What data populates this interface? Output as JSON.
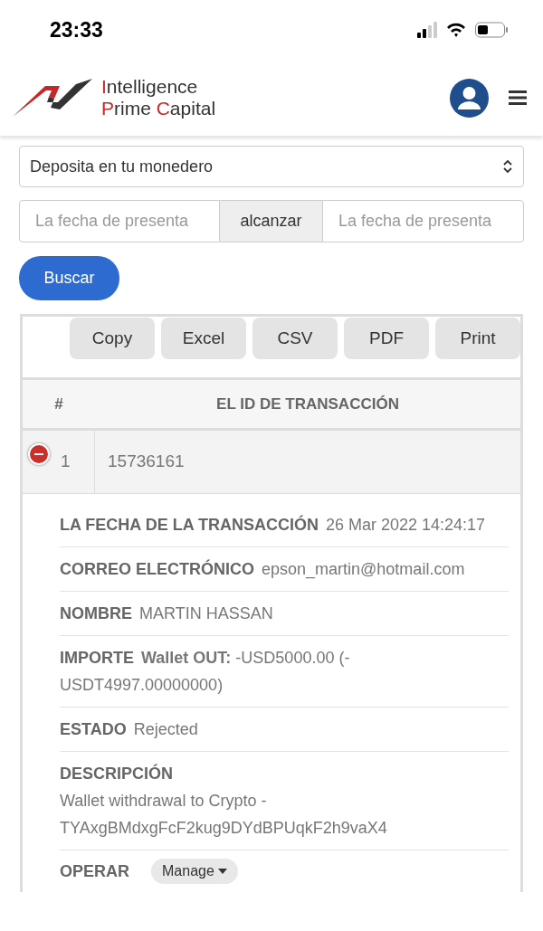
{
  "status_bar": {
    "time": "23:33"
  },
  "brand": {
    "lines": [
      [
        {
          "text": "I",
          "accent": true
        },
        {
          "text": "ntelligence",
          "accent": false
        }
      ],
      [
        {
          "text": "P",
          "accent": true
        },
        {
          "text": "rime ",
          "accent": false
        },
        {
          "text": "C",
          "accent": true
        },
        {
          "text": "apital",
          "accent": false
        }
      ]
    ]
  },
  "filter": {
    "select": "Deposita en tu monedero",
    "date_from": {
      "placeholder": "La fecha de presenta"
    },
    "range_label": "alcanzar",
    "date_to": {
      "placeholder": "La fecha de presenta"
    },
    "search_button": "Buscar"
  },
  "export_buttons": [
    "Copy",
    "Excel",
    "CSV",
    "PDF",
    "Print"
  ],
  "table": {
    "columns": [
      "#",
      "EL ID DE TRANSACCIÓN"
    ],
    "rows": [
      {
        "expanded": true,
        "index": "1",
        "id": "15736161"
      }
    ]
  },
  "details": [
    {
      "kind": "inline",
      "label": "LA FECHA DE LA TRANSACCIÓN",
      "value": "26 Mar 2022 14:24:17"
    },
    {
      "kind": "inline",
      "label": "CORREO ELECTRÓNICO",
      "value": "epson_martin@hotmail.com"
    },
    {
      "kind": "inline",
      "label": "NOMBRE",
      "value": "MARTIN HASSAN"
    },
    {
      "kind": "inline",
      "label": "IMPORTE",
      "value": "**Wallet OUT:** -USD5000.00 (-USDT4997.00000000)"
    },
    {
      "kind": "inline",
      "label": "ESTADO",
      "value": "Rejected"
    },
    {
      "kind": "stacked",
      "label": "DESCRIPCIÓN",
      "value": "Wallet withdrawal to Crypto - TYAxgBMdxgFcF2kug9DYdBPUqkF2h9vaX4"
    },
    {
      "kind": "action",
      "label": "OPERAR",
      "value": "Manage"
    }
  ]
}
